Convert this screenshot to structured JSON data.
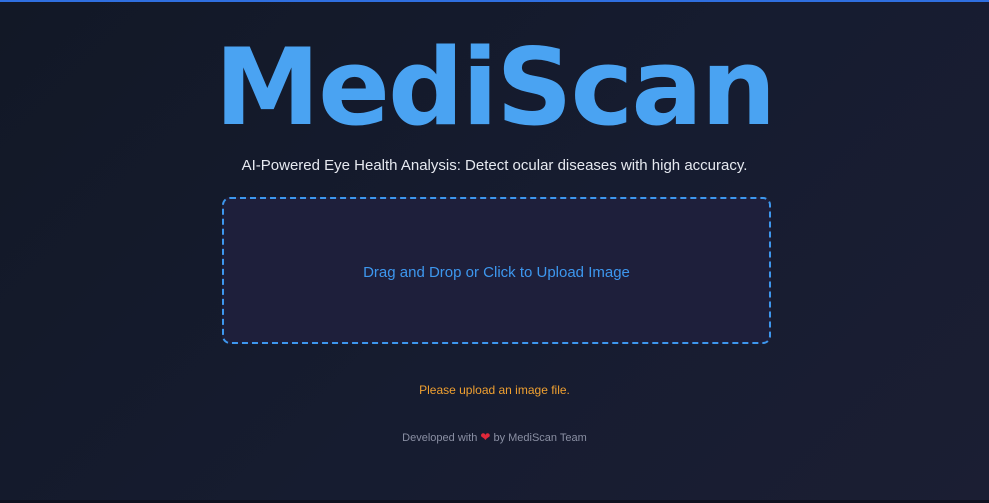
{
  "app": {
    "title": "MediScan",
    "subtitle": "AI-Powered Eye Health Analysis: Detect ocular diseases with high accuracy."
  },
  "upload": {
    "label": "Drag and Drop or Click to Upload Image"
  },
  "status": {
    "message": "Please upload an image file."
  },
  "footer": {
    "prefix": "Developed with",
    "heart": "❤",
    "suffix": "by MediScan Team"
  },
  "colors": {
    "accent": "#4aa3f2",
    "upload_border": "#3d97ee",
    "warning": "#f0a030",
    "heart": "#e0283a",
    "top_border": "#2f6fe0"
  },
  "icons": {
    "heart": "heart-icon"
  }
}
